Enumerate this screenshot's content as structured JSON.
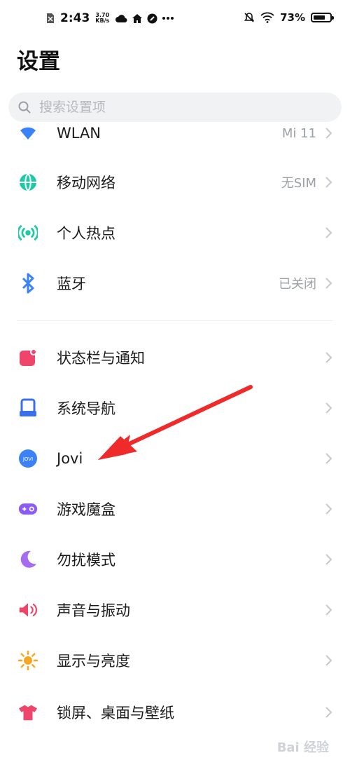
{
  "status_bar": {
    "time": "2:43",
    "speed_value": "3.70",
    "speed_unit": "KB/s",
    "battery_text": "73%",
    "battery_level": 0.73,
    "icons": [
      "sim-off-icon",
      "cloud-icon",
      "home-icon",
      "status-dot-icon",
      "more-dots-icon",
      "mute-icon",
      "wifi-icon",
      "battery-icon"
    ]
  },
  "page": {
    "title": "设置"
  },
  "search": {
    "placeholder": "搜索设置项"
  },
  "settings": [
    {
      "label": "WLAN",
      "value": "Mi 11",
      "icon": "wifi-icon",
      "color": "#3b82f6"
    },
    {
      "label": "移动网络",
      "value": "无SIM",
      "icon": "globe-icon",
      "color": "#1ec9a5"
    },
    {
      "label": "个人热点",
      "value": "",
      "icon": "hotspot-icon",
      "color": "#1ec9a5"
    },
    {
      "label": "蓝牙",
      "value": "已关闭",
      "icon": "bluetooth-icon",
      "color": "#3b82f6"
    },
    {
      "label": "状态栏与通知",
      "value": "",
      "icon": "notification-icon",
      "color": "#f0456b"
    },
    {
      "label": "系统导航",
      "value": "",
      "icon": "navigation-icon",
      "color": "#3b6fe8"
    },
    {
      "label": "Jovi",
      "value": "",
      "icon": "jovi-icon",
      "color": "#3b82f6"
    },
    {
      "label": "游戏魔盒",
      "value": "",
      "icon": "gamepad-icon",
      "color": "#8b5cf6"
    },
    {
      "label": "勿扰模式",
      "value": "",
      "icon": "moon-icon",
      "color": "#a56cf0"
    },
    {
      "label": "声音与振动",
      "value": "",
      "icon": "speaker-icon",
      "color": "#f0456b"
    },
    {
      "label": "显示与亮度",
      "value": "",
      "icon": "sun-icon",
      "color": "#f5a623"
    },
    {
      "label": "锁屏、桌面与壁纸",
      "value": "",
      "icon": "shirt-icon",
      "color": "#f0456b"
    }
  ],
  "watermark": "Bai 经验"
}
